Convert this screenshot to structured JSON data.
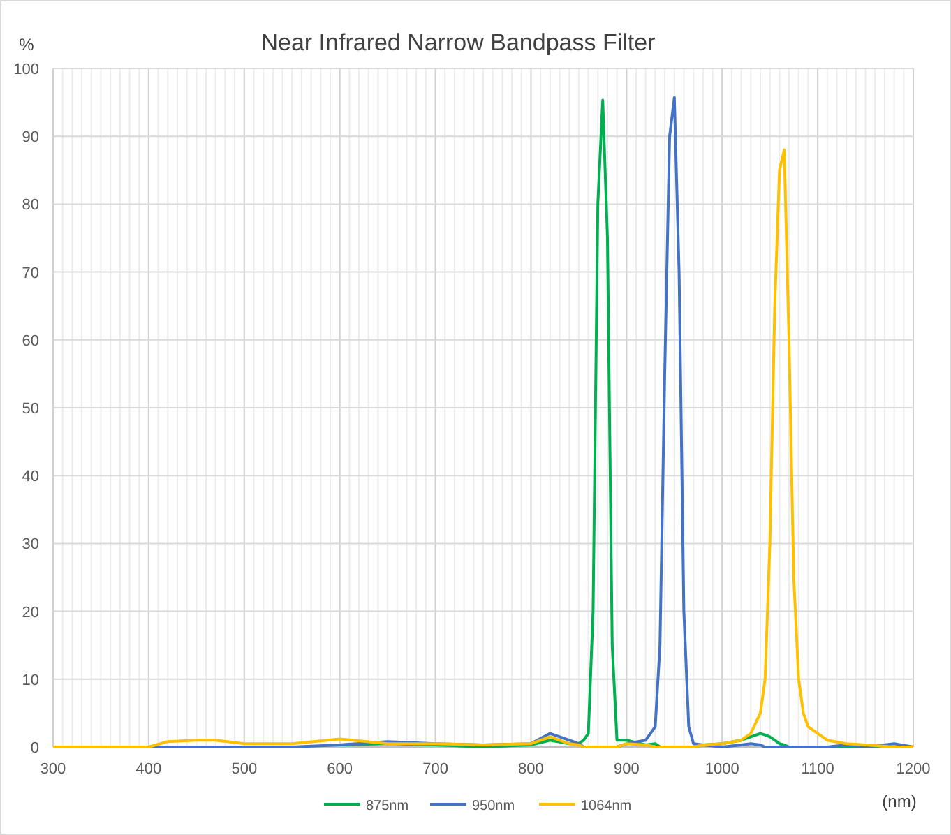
{
  "chart_data": {
    "type": "line",
    "title": "Near Infrared Narrow Bandpass Filter",
    "xlabel": "(nm)",
    "ylabel": "%",
    "x": [
      300,
      350,
      400,
      420,
      450,
      470,
      500,
      550,
      600,
      650,
      700,
      750,
      800,
      820,
      840,
      850,
      855,
      860,
      865,
      870,
      875,
      880,
      885,
      890,
      900,
      920,
      930,
      935,
      940,
      945,
      950,
      955,
      960,
      965,
      970,
      980,
      1000,
      1020,
      1030,
      1040,
      1045,
      1050,
      1055,
      1060,
      1065,
      1070,
      1075,
      1080,
      1085,
      1090,
      1100,
      1110,
      1130,
      1150,
      1180,
      1200
    ],
    "series": [
      {
        "name": "875nm",
        "color": "#00b050",
        "values": [
          null,
          null,
          null,
          null,
          null,
          null,
          null,
          null,
          0.3,
          0.5,
          0.3,
          0,
          0.3,
          1,
          0.5,
          0.5,
          1,
          2,
          20,
          80,
          95.3,
          75,
          15,
          1,
          1,
          0.3,
          0.5,
          0,
          0,
          0,
          0,
          0,
          0,
          0,
          0,
          0.3,
          0.5,
          1,
          1.5,
          2,
          1.8,
          1.5,
          1,
          0.5,
          0.3,
          0,
          0,
          0,
          0,
          0,
          0,
          0,
          0,
          0,
          0,
          0
        ]
      },
      {
        "name": "950nm",
        "color": "#4472c4",
        "values": [
          0,
          0,
          0,
          0,
          0,
          0,
          0,
          0,
          0.3,
          0.8,
          0.5,
          0.3,
          0.5,
          2,
          1,
          0.5,
          0,
          0,
          0,
          0,
          0,
          0,
          0,
          0,
          0.5,
          1,
          3,
          15,
          55,
          90,
          95.7,
          70,
          20,
          3,
          0.5,
          0.3,
          0,
          0.3,
          0.5,
          0.3,
          0,
          0,
          0,
          0,
          0,
          0,
          0,
          0,
          0,
          0,
          0,
          0,
          0.3,
          0,
          0.5,
          0
        ]
      },
      {
        "name": "1064nm",
        "color": "#ffc000",
        "values": [
          0,
          0,
          0,
          0.8,
          1,
          1,
          0.5,
          0.5,
          1.2,
          0.5,
          0.5,
          0.3,
          0.5,
          1.5,
          0.5,
          0.3,
          0,
          0,
          0,
          0,
          0,
          0,
          0,
          0,
          0.5,
          0.3,
          0,
          0,
          0,
          0,
          0,
          0,
          0,
          0,
          0,
          0.3,
          0.5,
          1,
          2,
          5,
          10,
          30,
          65,
          85,
          88,
          60,
          25,
          10,
          5,
          3,
          2,
          1,
          0.5,
          0.3,
          0,
          0
        ]
      }
    ],
    "grid": true,
    "legend": "bottom",
    "xlim": [
      300,
      1200
    ],
    "ylim": [
      0,
      100
    ],
    "xticks": [
      300,
      400,
      500,
      600,
      700,
      800,
      900,
      1000,
      1100,
      1200
    ],
    "yticks": [
      0,
      10,
      20,
      30,
      40,
      50,
      60,
      70,
      80,
      90,
      100
    ]
  }
}
